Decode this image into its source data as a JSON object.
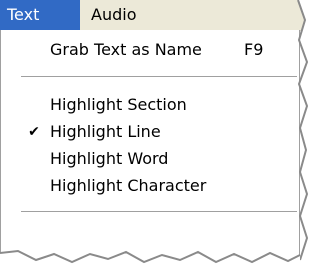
{
  "menubar": {
    "items": [
      {
        "label": "Text"
      },
      {
        "label": "Audio"
      }
    ]
  },
  "menu": {
    "grab": {
      "label": "Grab Text as Name",
      "shortcut": "F9"
    },
    "items": [
      {
        "label": "Highlight Section",
        "checked": false
      },
      {
        "label": "Highlight Line",
        "checked": true
      },
      {
        "label": "Highlight Word",
        "checked": false
      },
      {
        "label": "Highlight Character",
        "checked": false
      }
    ]
  },
  "icons": {
    "check": "✔"
  },
  "colors": {
    "menubar_bg": "#ece9d8",
    "highlight_bg": "#316ac5",
    "highlight_text": "#ffffff",
    "separator": "#a0a0a0"
  }
}
